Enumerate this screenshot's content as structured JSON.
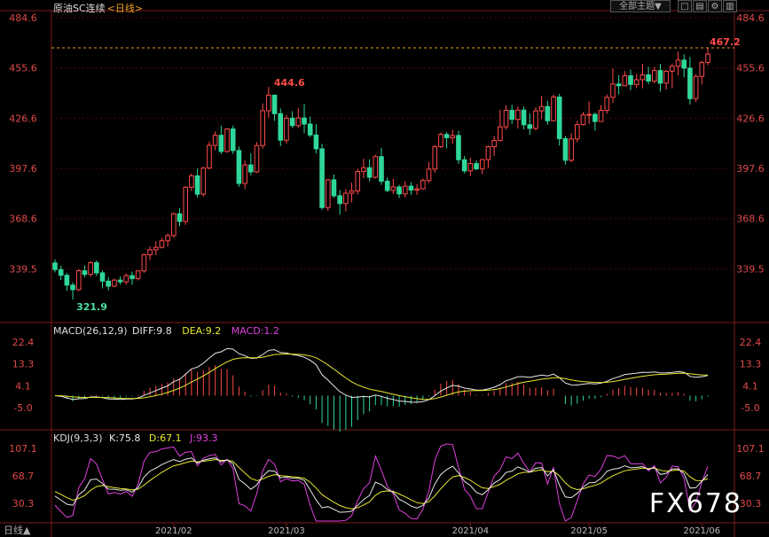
{
  "header": {
    "symbol": "原油SC连续",
    "period": "<日线>",
    "theme_button": "全部主题▼",
    "icons": [
      "window-single-icon",
      "window-split-icon",
      "settings-icon",
      "chart-icon",
      "arrow-down-icon"
    ]
  },
  "colors": {
    "up": "#ff4a4a",
    "down": "#2fd89a",
    "price_axis": "#e04848",
    "grid": "#4a0a0a",
    "macd_white": "#e8e8e8",
    "macd_yellow": "#e8e830",
    "macd_magenta": "#e040e0",
    "annotation_red": "#ff4a4a",
    "annotation_green": "#4fe0a0"
  },
  "chart_data": {
    "type": "candlestick",
    "x_months": [
      "2021/02",
      "2021/03",
      "2021/04",
      "2021/05",
      "2021/06"
    ],
    "price_axis_ticks": [
      "484.6",
      "455.6",
      "426.6",
      "397.6",
      "368.6",
      "339.5"
    ],
    "price_ylim": [
      321.9,
      484.6
    ],
    "high_marker": "467.2",
    "peak_marker": "444.6",
    "low_marker": "321.9",
    "ohlc": [
      [
        343.0,
        345.1,
        337.6,
        339.2
      ],
      [
        339.2,
        341.5,
        333.1,
        335.9
      ],
      [
        335.9,
        337.3,
        327.0,
        330.2
      ],
      [
        330.2,
        331.8,
        321.9,
        327.6
      ],
      [
        327.6,
        339.4,
        326.7,
        338.5
      ],
      [
        338.5,
        341.6,
        334.8,
        336.4
      ],
      [
        336.4,
        344.0,
        335.1,
        343.2
      ],
      [
        343.2,
        344.4,
        335.5,
        337.3
      ],
      [
        337.3,
        338.7,
        328.3,
        332.5
      ],
      [
        332.5,
        334.7,
        327.2,
        329.6
      ],
      [
        329.6,
        333.9,
        329.0,
        333.1
      ],
      [
        333.1,
        335.2,
        330.6,
        332.1
      ],
      [
        332.1,
        337.1,
        330.4,
        335.7
      ],
      [
        335.7,
        338.0,
        330.4,
        334.0
      ],
      [
        334.0,
        338.7,
        332.9,
        338.4
      ],
      [
        338.4,
        348.5,
        337.3,
        347.7
      ],
      [
        347.7,
        352.6,
        344.6,
        350.6
      ],
      [
        350.6,
        355.5,
        347.5,
        352.0
      ],
      [
        352.0,
        357.4,
        351.3,
        355.8
      ],
      [
        355.8,
        360.1,
        352.4,
        358.8
      ],
      [
        358.8,
        372.1,
        357.6,
        371.4
      ],
      [
        371.4,
        374.8,
        364.2,
        367.0
      ],
      [
        367.0,
        387.3,
        365.0,
        386.7
      ],
      [
        386.7,
        394.8,
        384.7,
        393.3
      ],
      [
        393.3,
        397.6,
        380.8,
        382.7
      ],
      [
        382.7,
        398.5,
        381.4,
        397.8
      ],
      [
        397.8,
        413.1,
        397.1,
        410.9
      ],
      [
        410.9,
        419.0,
        408.1,
        416.7
      ],
      [
        416.7,
        422.3,
        405.9,
        407.4
      ],
      [
        407.4,
        420.9,
        406.6,
        420.4
      ],
      [
        420.4,
        422.3,
        406.0,
        407.9
      ],
      [
        407.9,
        410.3,
        387.0,
        388.9
      ],
      [
        388.9,
        402.1,
        385.7,
        399.6
      ],
      [
        399.6,
        406.2,
        393.7,
        395.6
      ],
      [
        395.6,
        412.8,
        395.0,
        410.8
      ],
      [
        410.8,
        435.1,
        409.0,
        430.9
      ],
      [
        430.9,
        444.6,
        426.9,
        439.9
      ],
      [
        439.9,
        440.2,
        425.0,
        429.2
      ],
      [
        429.2,
        432.2,
        410.4,
        413.9
      ],
      [
        413.9,
        428.4,
        411.8,
        426.6
      ],
      [
        426.6,
        430.6,
        420.9,
        422.3
      ],
      [
        422.3,
        432.5,
        421.0,
        426.7
      ],
      [
        426.7,
        434.7,
        417.9,
        423.2
      ],
      [
        423.2,
        427.6,
        415.7,
        416.9
      ],
      [
        416.9,
        423.2,
        406.2,
        408.9
      ],
      [
        408.9,
        411.8,
        373.8,
        375.0
      ],
      [
        375.0,
        391.5,
        373.1,
        391.0
      ],
      [
        391.0,
        394.1,
        380.6,
        381.8
      ],
      [
        381.8,
        385.1,
        371.0,
        377.3
      ],
      [
        377.3,
        385.6,
        372.9,
        383.3
      ],
      [
        383.3,
        389.5,
        377.9,
        384.6
      ],
      [
        384.6,
        397.3,
        382.4,
        395.8
      ],
      [
        395.8,
        403.2,
        392.0,
        398.0
      ],
      [
        398.0,
        402.8,
        390.2,
        392.5
      ],
      [
        392.5,
        405.5,
        391.7,
        404.4
      ],
      [
        404.4,
        409.5,
        388.1,
        390.2
      ],
      [
        390.2,
        392.3,
        383.8,
        384.9
      ],
      [
        384.9,
        391.6,
        382.8,
        386.9
      ],
      [
        386.9,
        388.1,
        380.5,
        382.9
      ],
      [
        382.9,
        390.3,
        380.7,
        387.3
      ],
      [
        387.3,
        389.7,
        382.3,
        385.1
      ],
      [
        385.1,
        388.5,
        382.3,
        385.8
      ],
      [
        385.8,
        391.8,
        385.4,
        390.6
      ],
      [
        390.6,
        401.3,
        389.2,
        397.2
      ],
      [
        397.2,
        411.1,
        395.0,
        410.1
      ],
      [
        410.1,
        418.3,
        409.4,
        417.2
      ],
      [
        417.2,
        418.5,
        409.2,
        415.3
      ],
      [
        415.3,
        419.9,
        411.7,
        416.6
      ],
      [
        416.6,
        419.3,
        400.2,
        402.6
      ],
      [
        402.6,
        404.8,
        394.7,
        396.2
      ],
      [
        396.2,
        403.7,
        393.1,
        400.4
      ],
      [
        400.4,
        402.2,
        396.7,
        397.3
      ],
      [
        397.3,
        403.1,
        394.3,
        402.7
      ],
      [
        402.7,
        410.8,
        397.9,
        410.1
      ],
      [
        410.1,
        416.4,
        404.7,
        413.7
      ],
      [
        413.7,
        431.6,
        413.2,
        421.6
      ],
      [
        421.6,
        434.1,
        420.0,
        431.1
      ],
      [
        431.1,
        434.3,
        423.2,
        425.9
      ],
      [
        425.9,
        433.4,
        420.6,
        431.3
      ],
      [
        431.3,
        433.3,
        420.1,
        422.8
      ],
      [
        422.8,
        429.4,
        417.0,
        420.7
      ],
      [
        420.7,
        432.9,
        419.6,
        430.8
      ],
      [
        430.8,
        439.5,
        426.1,
        433.3
      ],
      [
        433.3,
        436.7,
        422.8,
        425.1
      ],
      [
        425.1,
        440.2,
        424.9,
        438.8
      ],
      [
        438.8,
        440.7,
        410.8,
        414.8
      ],
      [
        414.8,
        416.4,
        399.8,
        402.3
      ],
      [
        402.3,
        418.0,
        401.1,
        414.6
      ],
      [
        414.6,
        425.1,
        412.7,
        422.9
      ],
      [
        422.9,
        430.2,
        422.3,
        428.5
      ],
      [
        428.5,
        436.2,
        423.2,
        428.8
      ],
      [
        428.8,
        429.8,
        419.4,
        424.7
      ],
      [
        424.7,
        434.2,
        424.6,
        431.1
      ],
      [
        431.1,
        440.3,
        429.2,
        438.6
      ],
      [
        438.6,
        455.3,
        435.3,
        446.3
      ],
      [
        446.3,
        451.3,
        440.3,
        445.3
      ],
      [
        445.3,
        453.8,
        445.0,
        451.1
      ],
      [
        451.1,
        454.7,
        442.7,
        446.1
      ],
      [
        446.1,
        452.2,
        443.9,
        448.8
      ],
      [
        448.8,
        458.0,
        443.8,
        451.6
      ],
      [
        451.6,
        456.2,
        446.2,
        448.0
      ],
      [
        448.0,
        456.2,
        446.7,
        454.1
      ],
      [
        454.1,
        457.9,
        441.9,
        446.8
      ],
      [
        446.8,
        454.4,
        443.1,
        453.7
      ],
      [
        453.7,
        458.2,
        443.8,
        456.6
      ],
      [
        456.6,
        465.0,
        451.4,
        460.1
      ],
      [
        460.1,
        463.5,
        450.2,
        455.5
      ],
      [
        455.5,
        462.0,
        434.5,
        437.9
      ],
      [
        437.9,
        451.9,
        435.9,
        450.7
      ],
      [
        450.7,
        459.8,
        446.1,
        458.8
      ],
      [
        458.8,
        467.2,
        457.2,
        463.6
      ]
    ],
    "macd": {
      "label": "MACD(26,12,9)",
      "diff_label": "DIFF:9.8",
      "dea_label": "DEA:9.2",
      "macd_label": "MACD:1.2",
      "ticks": [
        "22.4",
        "13.3",
        "4.1",
        "-5.0"
      ],
      "ylim": [
        -5.0,
        22.4
      ]
    },
    "kdj": {
      "label": "KDJ(9,3,3)",
      "k_label": "K:75.8",
      "d_label": "D:67.1",
      "j_label": "J:93.3",
      "ticks": [
        "107.1",
        "68.7",
        "30.3"
      ],
      "ylim": [
        30.3,
        107.1
      ]
    }
  },
  "footer": {
    "period_control": "日线▲",
    "watermark": "FX678"
  }
}
